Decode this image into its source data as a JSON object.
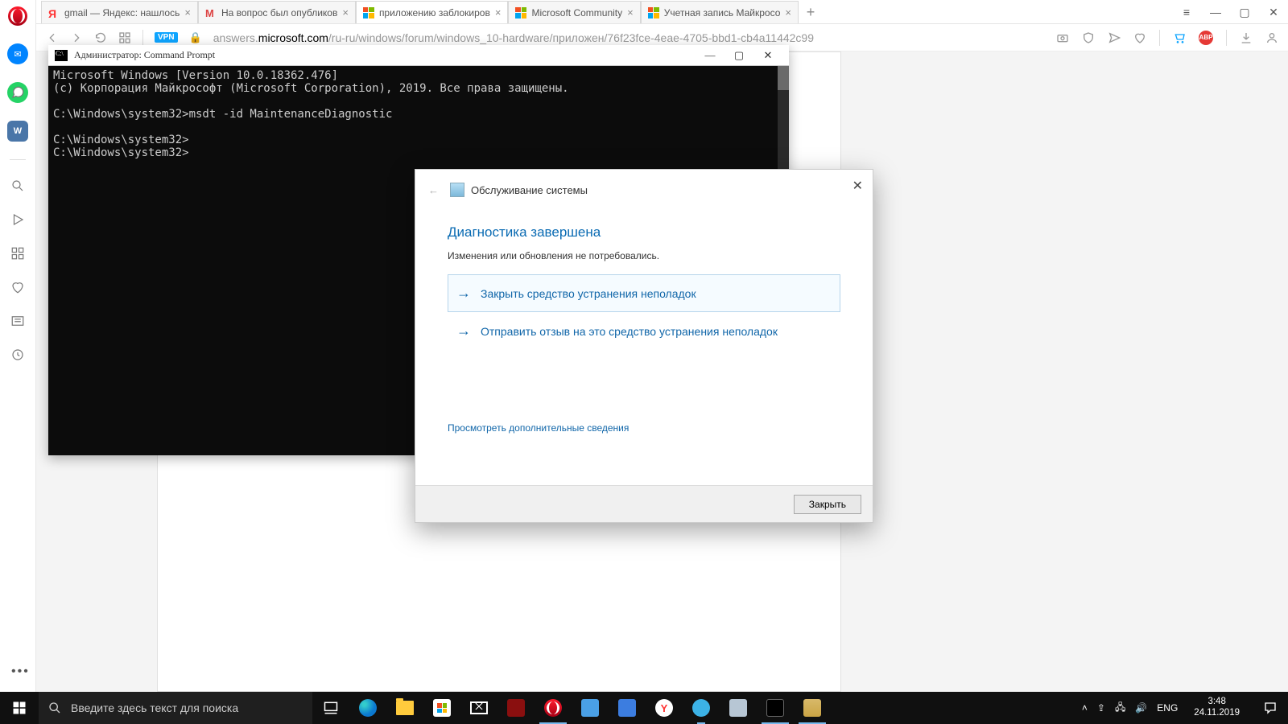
{
  "browser": {
    "tabs": [
      {
        "label": "gmail — Яндекс: нашлось"
      },
      {
        "label": "На вопрос был опубликов"
      },
      {
        "label": "приложению заблокиров"
      },
      {
        "label": "Microsoft Community"
      },
      {
        "label": "Учетная запись Майкросо"
      }
    ],
    "url_host": "answers.microsoft.com",
    "url_path": "/ru-ru/windows/forum/windows_10-hardware/приложен/76f23fce-4eae-4705-bbd1-cb4a11442c99",
    "vpn": "VPN"
  },
  "cmd": {
    "title": "Администратор: Command Prompt",
    "lines": "Microsoft Windows [Version 10.0.18362.476]\n(c) Корпорация Майкрософт (Microsoft Corporation), 2019. Все права защищены.\n\nC:\\Windows\\system32>msdt -id MaintenanceDiagnostic\n\nC:\\Windows\\system32>\nC:\\Windows\\system32>"
  },
  "dlg": {
    "title": "Обслуживание системы",
    "heading": "Диагностика завершена",
    "sub": "Изменения или обновления не потребовались.",
    "opt1": "Закрыть средство устранения неполадок",
    "opt2": "Отправить отзыв на это средство устранения неполадок",
    "more": "Просмотреть дополнительные сведения",
    "close": "Закрыть"
  },
  "taskbar": {
    "search_placeholder": "Введите здесь текст для поиска",
    "lang": "ENG",
    "time": "3:48",
    "date": "24.11.2019"
  }
}
